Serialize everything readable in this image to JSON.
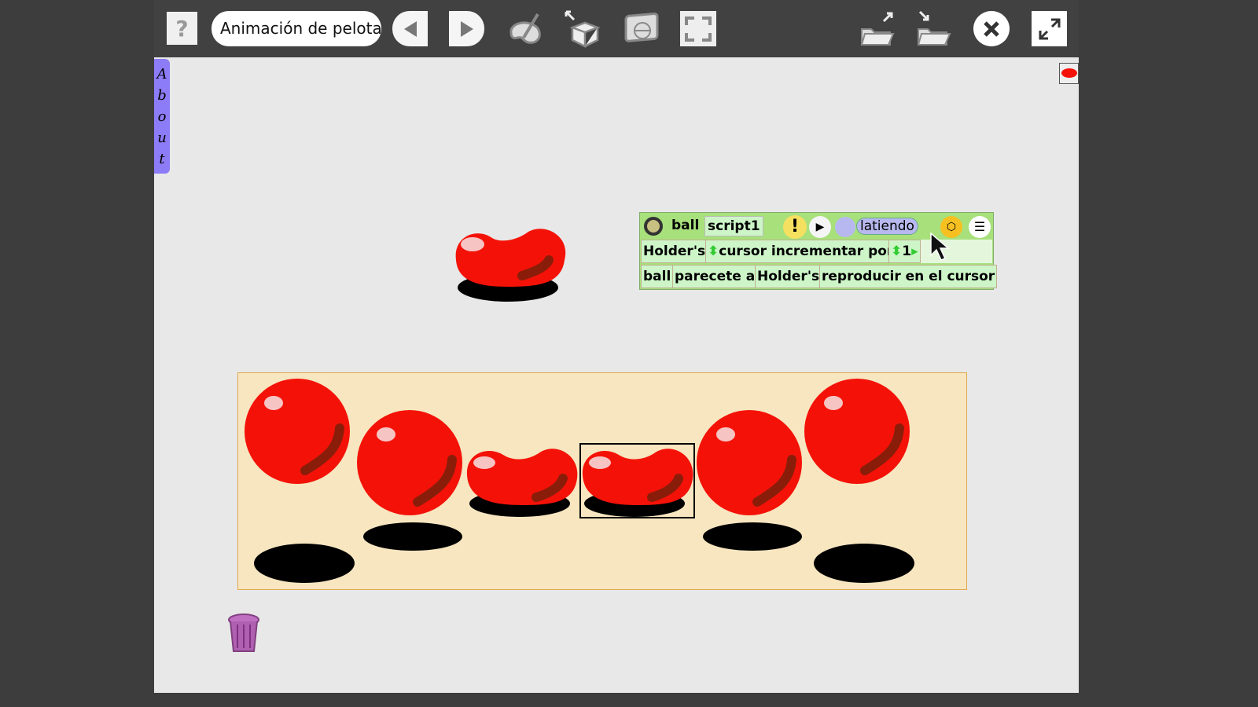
{
  "toolbar": {
    "help_icon": "question-icon",
    "project_title": "Animación de pelota",
    "buttons": [
      "previous-icon",
      "next-icon",
      "paint-icon",
      "supplies-icon",
      "navigator-icon",
      "fullscreen-icon",
      "open-folder-icon",
      "save-folder-icon",
      "close-icon",
      "expand-icon"
    ]
  },
  "flap": {
    "label_letters": [
      "A",
      "b",
      "o",
      "u",
      "t"
    ]
  },
  "scriptor": {
    "object": "ball",
    "script_name": "script1",
    "status": "latiendo",
    "row1": {
      "holder": "Holder's",
      "command": "cursor incrementar por",
      "value": "1"
    },
    "row2": {
      "object": "ball",
      "command": "parecete a",
      "holder": "Holder's",
      "arg": "reproducir en el cursor"
    }
  },
  "colors": {
    "ball": "#f41208",
    "holder": "#f7e6c0",
    "scriptor": "#a8e07c",
    "flap": "#8c7cf7"
  }
}
